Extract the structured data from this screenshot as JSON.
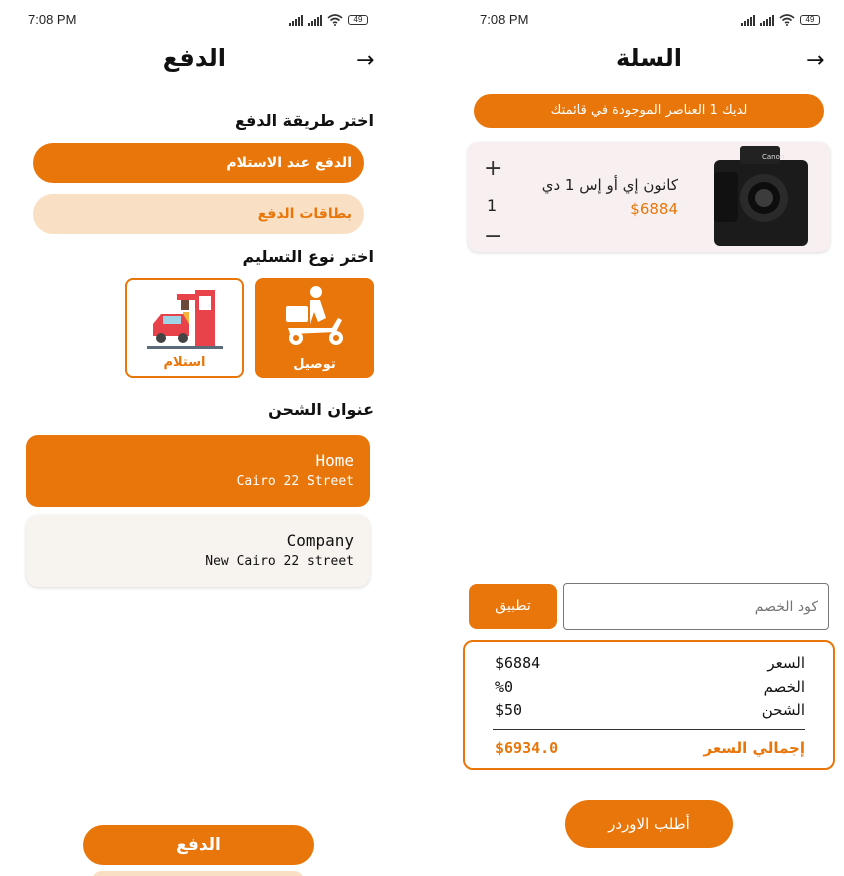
{
  "left": {
    "status": {
      "time": "7:08 PM",
      "battery": "49"
    },
    "title": "الدفع",
    "payment_method_heading": "اختر طريقة الدفع",
    "payment_options": [
      "الدفع عند الاستلام",
      "بطاقات الدفع"
    ],
    "delivery_type_heading": "اختر نوع التسليم",
    "delivery_options": [
      {
        "label": "توصيل",
        "icon": "delivery-scooter-icon"
      },
      {
        "label": "استلام",
        "icon": "pickup-car-icon"
      }
    ],
    "shipping_heading": "عنوان الشحن",
    "addresses": [
      {
        "name": "Home",
        "street": "Cairo  22 Street"
      },
      {
        "name": "Company",
        "street": "New Cairo  22 street"
      }
    ],
    "pay_button": "الدفع"
  },
  "right": {
    "status": {
      "time": "7:08 PM",
      "battery": "49"
    },
    "title": "السلة",
    "banner": "لديك 1 العناصر الموجودة في قائمتك",
    "item": {
      "name": "كانون إي أو إس 1 دي",
      "price": "$6884",
      "quantity": "1",
      "image": "camera-image",
      "brand_text": "Canon"
    },
    "coupon": {
      "apply_label": "تطبيق",
      "placeholder": "كود الخصم"
    },
    "summary": {
      "rows": [
        {
          "label": "السعر",
          "value": "$6884"
        },
        {
          "label": "الخصم",
          "value": "%0"
        },
        {
          "label": "الشحن",
          "value": "$50"
        }
      ],
      "total_label": "إجمالي السعر",
      "total_value": "$6934.0"
    },
    "order_button": "أطلب الاوردر"
  },
  "colors": {
    "accent": "#E8760A",
    "accent_light": "#F9DFC3",
    "card_bg": "#F8F0F0"
  }
}
